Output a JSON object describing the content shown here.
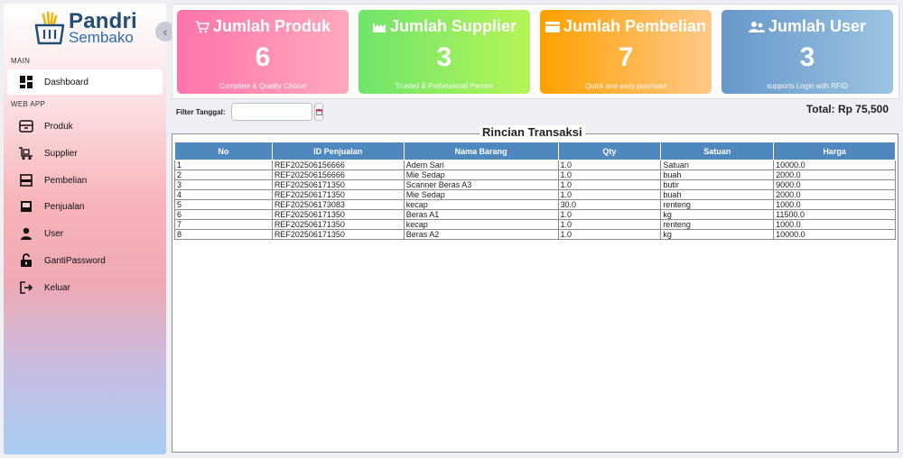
{
  "sidebar": {
    "logo_line1": "Pandri",
    "logo_line2": "Sembako",
    "section_main": "MAIN",
    "section_webapp": "WEB APP",
    "items": [
      {
        "label": "Dashboard",
        "icon": "dashboard-icon"
      },
      {
        "label": "Produk",
        "icon": "box-icon"
      },
      {
        "label": "Supplier",
        "icon": "truck-icon"
      },
      {
        "label": "Pembelian",
        "icon": "receipt-icon"
      },
      {
        "label": "Penjualan",
        "icon": "cash-register-icon"
      },
      {
        "label": "User",
        "icon": "user-icon"
      },
      {
        "label": "GantiPassword",
        "icon": "lock-icon"
      },
      {
        "label": "Keluar",
        "icon": "logout-icon"
      }
    ],
    "collapse_glyph": "‹"
  },
  "cards": [
    {
      "title": "Jumlah Produk",
      "value": "6",
      "subtitle": "Complete & Quality Choice",
      "icon": "cart-icon"
    },
    {
      "title": "Jumlah Supplier",
      "value": "3",
      "subtitle": "Trusted & Professional Partner",
      "icon": "factory-icon"
    },
    {
      "title": "Jumlah Pembelian",
      "value": "7",
      "subtitle": "Quick and easy purchase",
      "icon": "credit-card-icon"
    },
    {
      "title": "Jumlah User",
      "value": "3",
      "subtitle": "supports Login with RFID",
      "icon": "users-icon"
    }
  ],
  "filter": {
    "label": "Filter Tanggal:",
    "value": "",
    "placeholder": ""
  },
  "total": "Total: Rp 75,500",
  "transactions": {
    "title": "Rincian Transaksi",
    "columns": [
      "No",
      "ID Penjualan",
      "Nama Barang",
      "Qty",
      "Satuan",
      "Harga"
    ],
    "rows": [
      [
        "1",
        "REF202506156666",
        "Adem Sari",
        "1.0",
        "Satuan",
        "10000.0"
      ],
      [
        "2",
        "REF202506156666",
        "Mie Sedap",
        "1.0",
        "buah",
        "2000.0"
      ],
      [
        "3",
        "REF202506171350",
        "Scanner Beras A3",
        "1.0",
        "butir",
        "9000.0"
      ],
      [
        "4",
        "REF202506171350",
        "Mie Sedap",
        "1.0",
        "buah",
        "2000.0"
      ],
      [
        "5",
        "REF202506173083",
        "kecap",
        "30.0",
        "renteng",
        "1000.0"
      ],
      [
        "6",
        "REF202506171350",
        "Beras A1",
        "1.0",
        "kg",
        "11500.0"
      ],
      [
        "7",
        "REF202506171350",
        "kecap",
        "1.0",
        "renteng",
        "1000.0"
      ],
      [
        "8",
        "REF202506171350",
        "Beras A2",
        "1.0",
        "kg",
        "10000.0"
      ]
    ]
  }
}
